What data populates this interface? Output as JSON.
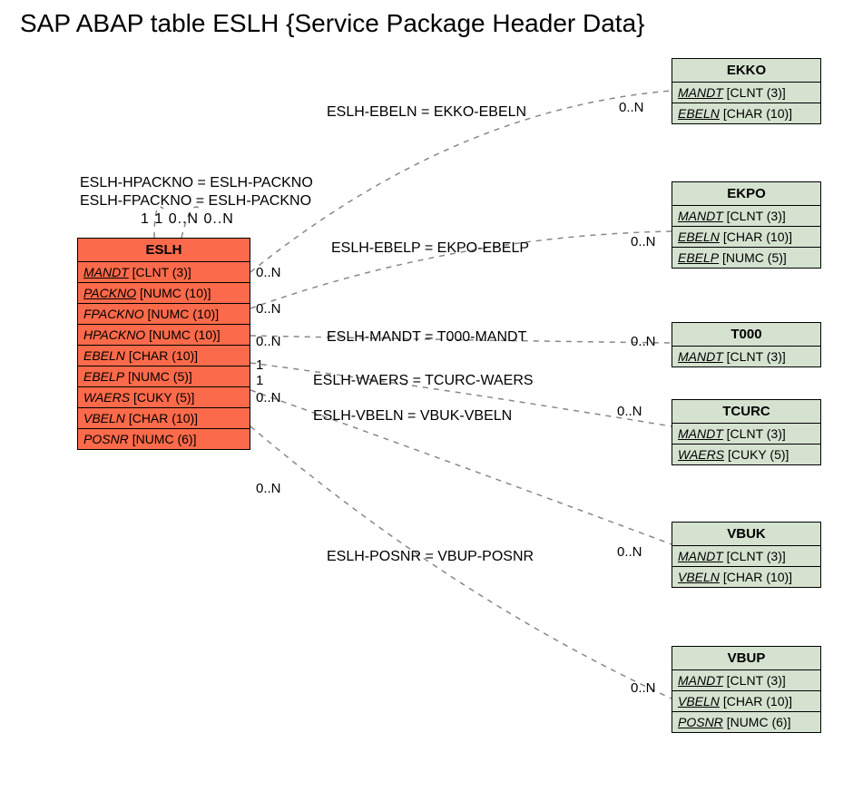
{
  "title": "SAP ABAP table ESLH {Service Package Header Data}",
  "mainEntity": {
    "name": "ESLH",
    "fields": [
      {
        "name": "MANDT",
        "type": "[CLNT (3)]",
        "key": true
      },
      {
        "name": "PACKNO",
        "type": "[NUMC (10)]",
        "key": true
      },
      {
        "name": "FPACKNO",
        "type": "[NUMC (10)]",
        "key": false
      },
      {
        "name": "HPACKNO",
        "type": "[NUMC (10)]",
        "key": false
      },
      {
        "name": "EBELN",
        "type": "[CHAR (10)]",
        "key": false
      },
      {
        "name": "EBELP",
        "type": "[NUMC (5)]",
        "key": false
      },
      {
        "name": "WAERS",
        "type": "[CUKY (5)]",
        "key": false
      },
      {
        "name": "VBELN",
        "type": "[CHAR (10)]",
        "key": false
      },
      {
        "name": "POSNR",
        "type": "[NUMC (6)]",
        "key": false
      }
    ]
  },
  "refEntities": {
    "ekko": {
      "name": "EKKO",
      "fields": [
        {
          "name": "MANDT",
          "type": "[CLNT (3)]",
          "key": true
        },
        {
          "name": "EBELN",
          "type": "[CHAR (10)]",
          "key": true
        }
      ]
    },
    "ekpo": {
      "name": "EKPO",
      "fields": [
        {
          "name": "MANDT",
          "type": "[CLNT (3)]",
          "key": true
        },
        {
          "name": "EBELN",
          "type": "[CHAR (10)]",
          "key": true
        },
        {
          "name": "EBELP",
          "type": "[NUMC (5)]",
          "key": true
        }
      ]
    },
    "t000": {
      "name": "T000",
      "fields": [
        {
          "name": "MANDT",
          "type": "[CLNT (3)]",
          "key": true
        }
      ]
    },
    "tcurc": {
      "name": "TCURC",
      "fields": [
        {
          "name": "MANDT",
          "type": "[CLNT (3)]",
          "key": true
        },
        {
          "name": "WAERS",
          "type": "[CUKY (5)]",
          "key": true
        }
      ]
    },
    "vbuk": {
      "name": "VBUK",
      "fields": [
        {
          "name": "MANDT",
          "type": "[CLNT (3)]",
          "key": true
        },
        {
          "name": "VBELN",
          "type": "[CHAR (10)]",
          "key": true
        }
      ]
    },
    "vbup": {
      "name": "VBUP",
      "fields": [
        {
          "name": "MANDT",
          "type": "[CLNT (3)]",
          "key": true
        },
        {
          "name": "VBELN",
          "type": "[CHAR (10)]",
          "key": true
        },
        {
          "name": "POSNR",
          "type": "[NUMC (6)]",
          "key": true
        }
      ]
    }
  },
  "relations": {
    "ekko": {
      "label": "ESLH-EBELN = EKKO-EBELN",
      "leftCard": "0..N",
      "rightCard": "0..N"
    },
    "ekpo": {
      "label": "ESLH-EBELP = EKPO-EBELP",
      "leftCard": "0..N",
      "rightCard": "0..N"
    },
    "t000": {
      "label": "ESLH-MANDT = T000-MANDT",
      "leftCard": "0..N",
      "rightCard": "0..N"
    },
    "tcurc": {
      "label": "ESLH-WAERS = TCURC-WAERS",
      "leftCard": "1",
      "rightCard": "1"
    },
    "vbuk": {
      "label": "ESLH-VBELN = VBUK-VBELN",
      "leftCard": "0..N",
      "rightCard": "0..N"
    },
    "vbup": {
      "label": "ESLH-POSNR = VBUP-POSNR",
      "leftCard": "0..N",
      "rightCard": "0..N"
    }
  },
  "selfRelations": {
    "line1": "ESLH-HPACKNO = ESLH-PACKNO",
    "line2": "ESLH-FPACKNO = ESLH-PACKNO",
    "cards": "1 1    0..N 0..N"
  }
}
